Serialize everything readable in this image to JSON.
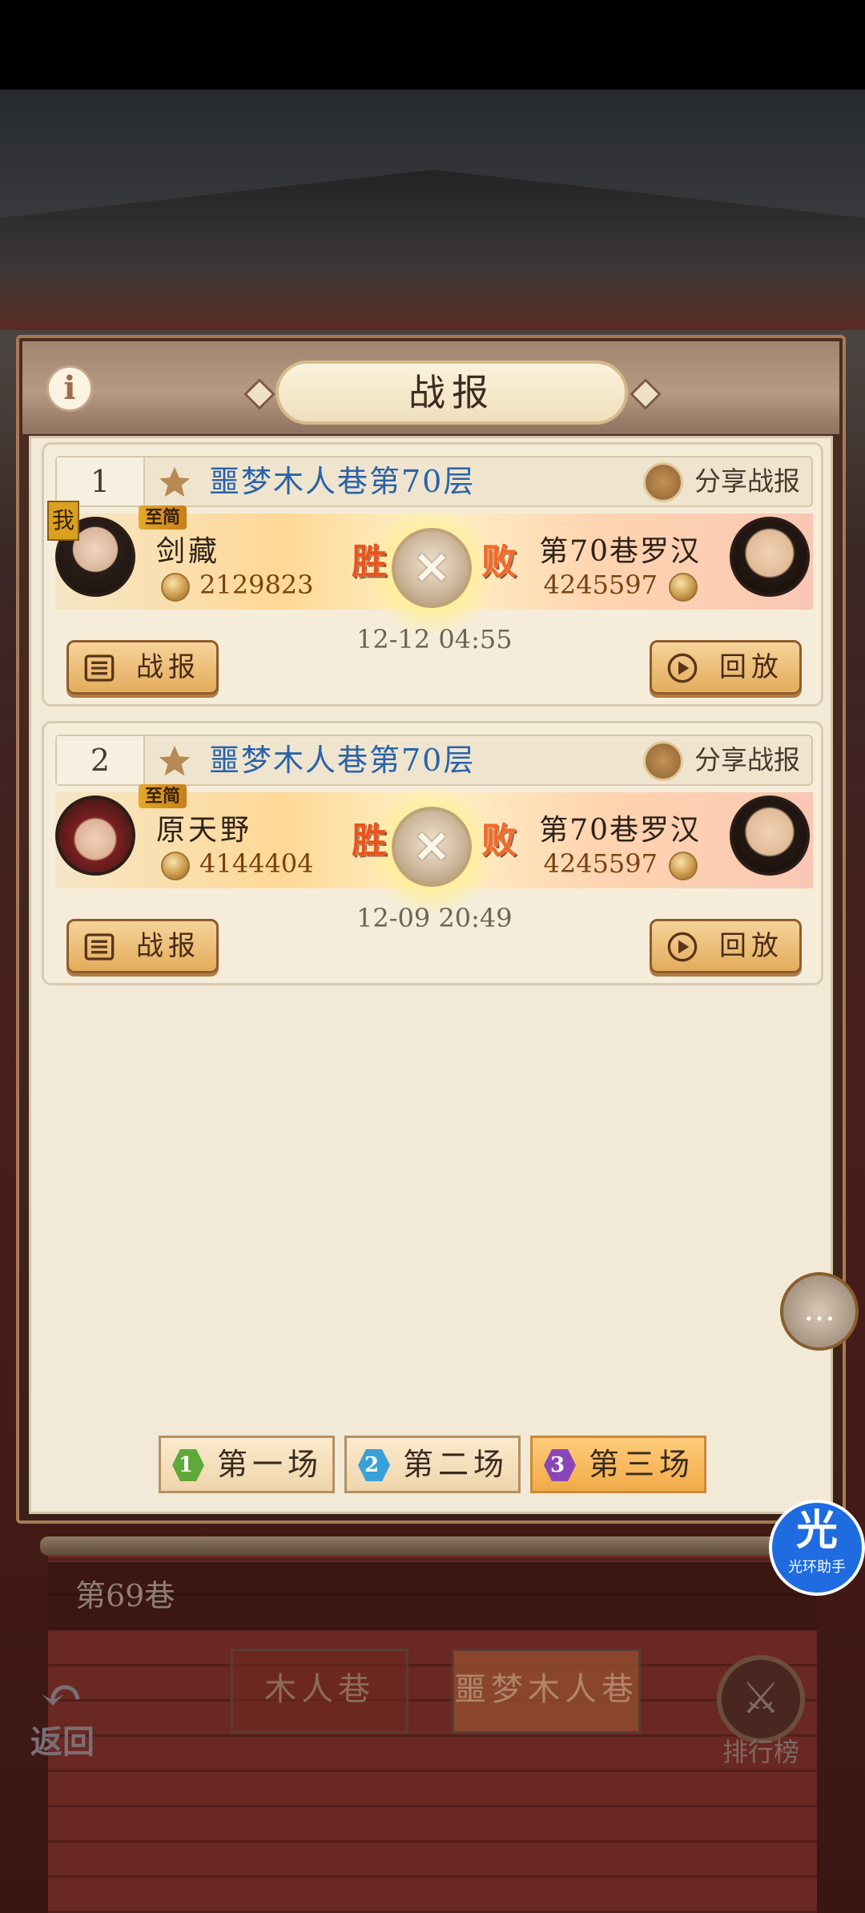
{
  "dialog": {
    "title": "战报"
  },
  "records": [
    {
      "index": "1",
      "title": "噩梦木人巷第70层",
      "share_label": "分享战报",
      "player": {
        "me_badge": "我",
        "rank": "至简",
        "name": "剑藏",
        "power": "2129823"
      },
      "result_left": "胜",
      "result_right": "败",
      "opponent": {
        "name": "第70巷罗汉",
        "power": "4245597"
      },
      "time": "12-12 04:55",
      "report_label": "战报",
      "replay_label": "回放"
    },
    {
      "index": "2",
      "title": "噩梦木人巷第70层",
      "share_label": "分享战报",
      "player": {
        "rank": "至简",
        "name": "原天野",
        "power": "4144404"
      },
      "result_left": "胜",
      "result_right": "败",
      "opponent": {
        "name": "第70巷罗汉",
        "power": "4245597"
      },
      "time": "12-09 20:49",
      "report_label": "战报",
      "replay_label": "回放"
    }
  ],
  "round_tabs": [
    {
      "num": "1",
      "label": "第一场",
      "color": "#5fa83a"
    },
    {
      "num": "2",
      "label": "第二场",
      "color": "#3aa0d8"
    },
    {
      "num": "3",
      "label": "第三场",
      "color": "#8a46b8"
    }
  ],
  "background": {
    "row_label": "第69巷",
    "tab_wooden": "木人巷",
    "tab_nightmare": "噩梦木人巷",
    "back_label": "返回",
    "rank_label": "排行榜"
  },
  "overlay": {
    "halo_glyph": "光",
    "halo_label": "光环助手"
  }
}
